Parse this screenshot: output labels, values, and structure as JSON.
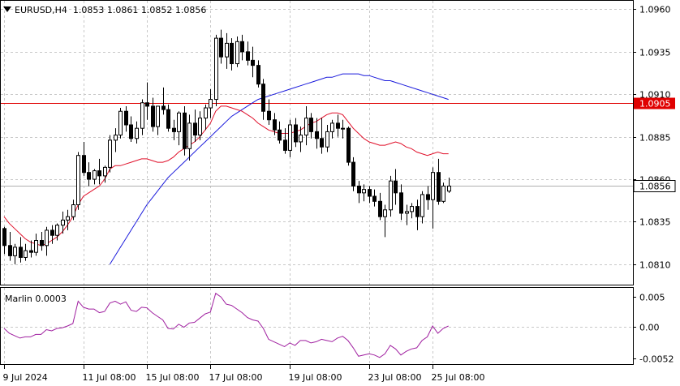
{
  "header": {
    "symbol": "EURUSD,H4",
    "ohlc": "1.0853 1.0861 1.0852 1.0856"
  },
  "indicator": {
    "label": "Marlin 0.0003"
  },
  "colors": {
    "bull_body": "#ffffff",
    "bear_body": "#000000",
    "wick": "#000000",
    "ma_fast": "#e0102a",
    "ma_slow": "#1a1adc",
    "hline": "#e00000",
    "osc": "#a020a0",
    "grid": "#c8c8c8"
  },
  "chart_data": [
    {
      "type": "candlestick",
      "title": "EURUSD,H4",
      "ylim": [
        1.0798,
        1.0965
      ],
      "y_ticks": [
        "1.0960",
        "1.0935",
        "1.0910",
        "1.0885",
        "1.0860",
        "1.0835",
        "1.0810"
      ],
      "x_ticks": [
        "9 Jul 2024",
        "11 Jul 08:00",
        "15 Jul 08:00",
        "17 Jul 08:00",
        "19 Jul 08:00",
        "23 Jul 08:00",
        "25 Jul 08:00"
      ],
      "grid": true,
      "horizontal_line": {
        "value": 1.0905,
        "label": "1.0905"
      },
      "current_price": {
        "value": 1.0856,
        "label": "1.0856"
      },
      "ohlc": [
        [
          1.0831,
          1.0832,
          1.0816,
          1.0821
        ],
        [
          1.0821,
          1.0829,
          1.0812,
          1.0815
        ],
        [
          1.0815,
          1.0822,
          1.081,
          1.082
        ],
        [
          1.082,
          1.0826,
          1.0811,
          1.0814
        ],
        [
          1.0814,
          1.0822,
          1.0812,
          1.0818
        ],
        [
          1.0818,
          1.0824,
          1.0814,
          1.0817
        ],
        [
          1.0817,
          1.0828,
          1.0815,
          1.0824
        ],
        [
          1.0824,
          1.0829,
          1.0818,
          1.0821
        ],
        [
          1.0821,
          1.0832,
          1.0815,
          1.083
        ],
        [
          1.083,
          1.0833,
          1.0822,
          1.0827
        ],
        [
          1.0827,
          1.0834,
          1.0824,
          1.0833
        ],
        [
          1.0833,
          1.0841,
          1.0828,
          1.0836
        ],
        [
          1.0836,
          1.0842,
          1.083,
          1.0838
        ],
        [
          1.0838,
          1.0848,
          1.0836,
          1.0845
        ],
        [
          1.0845,
          1.0876,
          1.0842,
          1.0874
        ],
        [
          1.0874,
          1.0882,
          1.0862,
          1.0864
        ],
        [
          1.0864,
          1.087,
          1.0856,
          1.086
        ],
        [
          1.086,
          1.0866,
          1.0857,
          1.0865
        ],
        [
          1.0865,
          1.0872,
          1.0857,
          1.0862
        ],
        [
          1.0862,
          1.0868,
          1.0858,
          1.0867
        ],
        [
          1.0867,
          1.0886,
          1.0864,
          1.0883
        ],
        [
          1.0883,
          1.089,
          1.0876,
          1.0886
        ],
        [
          1.0886,
          1.0902,
          1.0884,
          1.09
        ],
        [
          1.09,
          1.0903,
          1.0888,
          1.0892
        ],
        [
          1.0892,
          1.0897,
          1.0882,
          1.0884
        ],
        [
          1.0884,
          1.0894,
          1.0881,
          1.089
        ],
        [
          1.089,
          1.0907,
          1.0886,
          1.0905
        ],
        [
          1.0905,
          1.0917,
          1.0895,
          1.0903
        ],
        [
          1.0903,
          1.0908,
          1.0888,
          1.0891
        ],
        [
          1.0891,
          1.0903,
          1.0886,
          1.0903
        ],
        [
          1.0903,
          1.0914,
          1.0898,
          1.0901
        ],
        [
          1.0901,
          1.0904,
          1.0888,
          1.089
        ],
        [
          1.089,
          1.0895,
          1.0883,
          1.0888
        ],
        [
          1.0888,
          1.09,
          1.088,
          1.0899
        ],
        [
          1.0899,
          1.0903,
          1.0874,
          1.0878
        ],
        [
          1.0878,
          1.0898,
          1.0871,
          1.0893
        ],
        [
          1.0893,
          1.0901,
          1.0882,
          1.0886
        ],
        [
          1.0886,
          1.09,
          1.0883,
          1.0896
        ],
        [
          1.0896,
          1.0904,
          1.0889,
          1.0902
        ],
        [
          1.0902,
          1.0913,
          1.0896,
          1.0907
        ],
        [
          1.0907,
          1.0945,
          1.0903,
          1.0943
        ],
        [
          1.0943,
          1.0948,
          1.0928,
          1.0932
        ],
        [
          1.0932,
          1.0946,
          1.0925,
          1.094
        ],
        [
          1.094,
          1.0943,
          1.0924,
          1.0928
        ],
        [
          1.0928,
          1.0944,
          1.0926,
          1.0941
        ],
        [
          1.0941,
          1.0945,
          1.093,
          1.0935
        ],
        [
          1.0935,
          1.0941,
          1.0927,
          1.093
        ],
        [
          1.093,
          1.0938,
          1.092,
          1.0927
        ],
        [
          1.0927,
          1.093,
          1.0914,
          1.0916
        ],
        [
          1.0916,
          1.0919,
          1.0895,
          1.09
        ],
        [
          1.09,
          1.0907,
          1.0892,
          1.0895
        ],
        [
          1.0895,
          1.0899,
          1.0886,
          1.0889
        ],
        [
          1.0889,
          1.0894,
          1.0881,
          1.0883
        ],
        [
          1.0883,
          1.089,
          1.0875,
          1.0877
        ],
        [
          1.0877,
          1.0895,
          1.0873,
          1.0892
        ],
        [
          1.0892,
          1.0896,
          1.0879,
          1.0882
        ],
        [
          1.0882,
          1.0891,
          1.0876,
          1.0886
        ],
        [
          1.0886,
          1.0903,
          1.088,
          1.0896
        ],
        [
          1.0896,
          1.0899,
          1.0884,
          1.0888
        ],
        [
          1.0888,
          1.0896,
          1.0878,
          1.0884
        ],
        [
          1.0884,
          1.0896,
          1.0875,
          1.0879
        ],
        [
          1.0879,
          1.0892,
          1.0876,
          1.0888
        ],
        [
          1.0888,
          1.0895,
          1.0884,
          1.0893
        ],
        [
          1.0893,
          1.0898,
          1.0885,
          1.089
        ],
        [
          1.089,
          1.0895,
          1.0884,
          1.089
        ],
        [
          1.089,
          1.0891,
          1.0868,
          1.087
        ],
        [
          1.087,
          1.0873,
          1.0853,
          1.0856
        ],
        [
          1.0856,
          1.0859,
          1.0846,
          1.0852
        ],
        [
          1.0852,
          1.0857,
          1.0847,
          1.0854
        ],
        [
          1.0854,
          1.0856,
          1.0846,
          1.085
        ],
        [
          1.085,
          1.0854,
          1.0844,
          1.0847
        ],
        [
          1.0847,
          1.0852,
          1.0836,
          1.0838
        ],
        [
          1.0838,
          1.0845,
          1.0826,
          1.0842
        ],
        [
          1.0842,
          1.0862,
          1.0838,
          1.0859
        ],
        [
          1.0859,
          1.0866,
          1.0845,
          1.0852
        ],
        [
          1.0852,
          1.0857,
          1.0836,
          1.084
        ],
        [
          1.084,
          1.0845,
          1.0833,
          1.0841
        ],
        [
          1.0841,
          1.0846,
          1.0837,
          1.0844
        ],
        [
          1.0844,
          1.0848,
          1.083,
          1.0838
        ],
        [
          1.0838,
          1.0853,
          1.0834,
          1.0851
        ],
        [
          1.0851,
          1.0856,
          1.0842,
          1.0848
        ],
        [
          1.0848,
          1.0867,
          1.0831,
          1.0864
        ],
        [
          1.0864,
          1.0872,
          1.0845,
          1.0847
        ],
        [
          1.0847,
          1.0858,
          1.0846,
          1.0856
        ],
        [
          1.0853,
          1.0861,
          1.0852,
          1.0856
        ]
      ],
      "ma_fast": [
        1.0838,
        1.0834,
        1.0831,
        1.0828,
        1.0825,
        1.0823,
        1.0822,
        1.0821,
        1.0822,
        1.0824,
        1.0826,
        1.0829,
        1.0833,
        1.0838,
        1.0845,
        1.085,
        1.0852,
        1.0854,
        1.0856,
        1.086,
        1.0866,
        1.0868,
        1.0868,
        1.0869,
        1.087,
        1.0871,
        1.0872,
        1.0872,
        1.0871,
        1.087,
        1.087,
        1.0871,
        1.0873,
        1.0876,
        1.0878,
        1.088,
        1.0882,
        1.0885,
        1.0889,
        1.0893,
        1.09,
        1.0903,
        1.0903,
        1.0902,
        1.0901,
        1.09,
        1.0898,
        1.0896,
        1.0893,
        1.0891,
        1.0889,
        1.0888,
        1.0887,
        1.0887,
        1.0887,
        1.0888,
        1.0889,
        1.0891,
        1.0893,
        1.0894,
        1.0896,
        1.0898,
        1.0899,
        1.0899,
        1.0898,
        1.0894,
        1.089,
        1.0887,
        1.0884,
        1.0882,
        1.0881,
        1.088,
        1.088,
        1.0881,
        1.0882,
        1.0881,
        1.0879,
        1.0878,
        1.0876,
        1.0875,
        1.0874,
        1.0875,
        1.0876,
        1.0875,
        1.0875
      ],
      "ma_slow": [
        null,
        null,
        null,
        null,
        null,
        null,
        null,
        null,
        null,
        null,
        null,
        null,
        null,
        null,
        null,
        null,
        null,
        null,
        null,
        null,
        1.081,
        1.0815,
        1.082,
        1.0825,
        1.083,
        1.0835,
        1.084,
        1.0845,
        1.0849,
        1.0853,
        1.0857,
        1.0861,
        1.0864,
        1.0867,
        1.087,
        1.0873,
        1.0876,
        1.0879,
        1.0882,
        1.0885,
        1.0888,
        1.0891,
        1.0894,
        1.0897,
        1.0899,
        1.0901,
        1.0903,
        1.0905,
        1.0907,
        1.0908,
        1.0909,
        1.091,
        1.0911,
        1.0912,
        1.0913,
        1.0914,
        1.0915,
        1.0916,
        1.0917,
        1.0918,
        1.0919,
        1.092,
        1.092,
        1.0921,
        1.0922,
        1.0922,
        1.0922,
        1.0922,
        1.0921,
        1.0921,
        1.092,
        1.0919,
        1.0918,
        1.0918,
        1.0917,
        1.0916,
        1.0915,
        1.0914,
        1.0913,
        1.0912,
        1.0911,
        1.091,
        1.0909,
        1.0908,
        1.0907
      ]
    },
    {
      "type": "line",
      "title": "Marlin 0.0003",
      "ylim": [
        -0.0061,
        0.0065
      ],
      "y_ticks": [
        "0.005",
        "0.00",
        "-0.0052"
      ],
      "zero_line": 0,
      "values": [
        -0.0002,
        -0.001,
        -0.0014,
        -0.0018,
        -0.0016,
        -0.0016,
        -0.0012,
        -0.0012,
        -0.0004,
        -0.0006,
        -0.0002,
        -0.0001,
        0.0002,
        0.0006,
        0.0043,
        0.0033,
        0.003,
        0.003,
        0.0024,
        0.0026,
        0.004,
        0.0043,
        0.0038,
        0.0042,
        0.0028,
        0.0026,
        0.0033,
        0.0032,
        0.0024,
        0.0018,
        0.0012,
        -0.0002,
        -0.0003,
        0.0005,
        0.0,
        0.0007,
        0.0008,
        0.0015,
        0.0022,
        0.0025,
        0.0056,
        0.005,
        0.0038,
        0.0036,
        0.003,
        0.0024,
        0.0016,
        0.0012,
        0.001,
        -0.0002,
        -0.002,
        -0.0024,
        -0.0028,
        -0.0032,
        -0.0026,
        -0.003,
        -0.0022,
        -0.0022,
        -0.0026,
        -0.0024,
        -0.002,
        -0.0022,
        -0.0024,
        -0.0018,
        -0.0015,
        -0.0022,
        -0.0034,
        -0.0048,
        -0.0046,
        -0.0044,
        -0.0046,
        -0.005,
        -0.0044,
        -0.003,
        -0.0036,
        -0.0046,
        -0.004,
        -0.0036,
        -0.0034,
        -0.0022,
        -0.0016,
        0.0002,
        -0.001,
        -0.0002,
        0.0002
      ]
    }
  ]
}
